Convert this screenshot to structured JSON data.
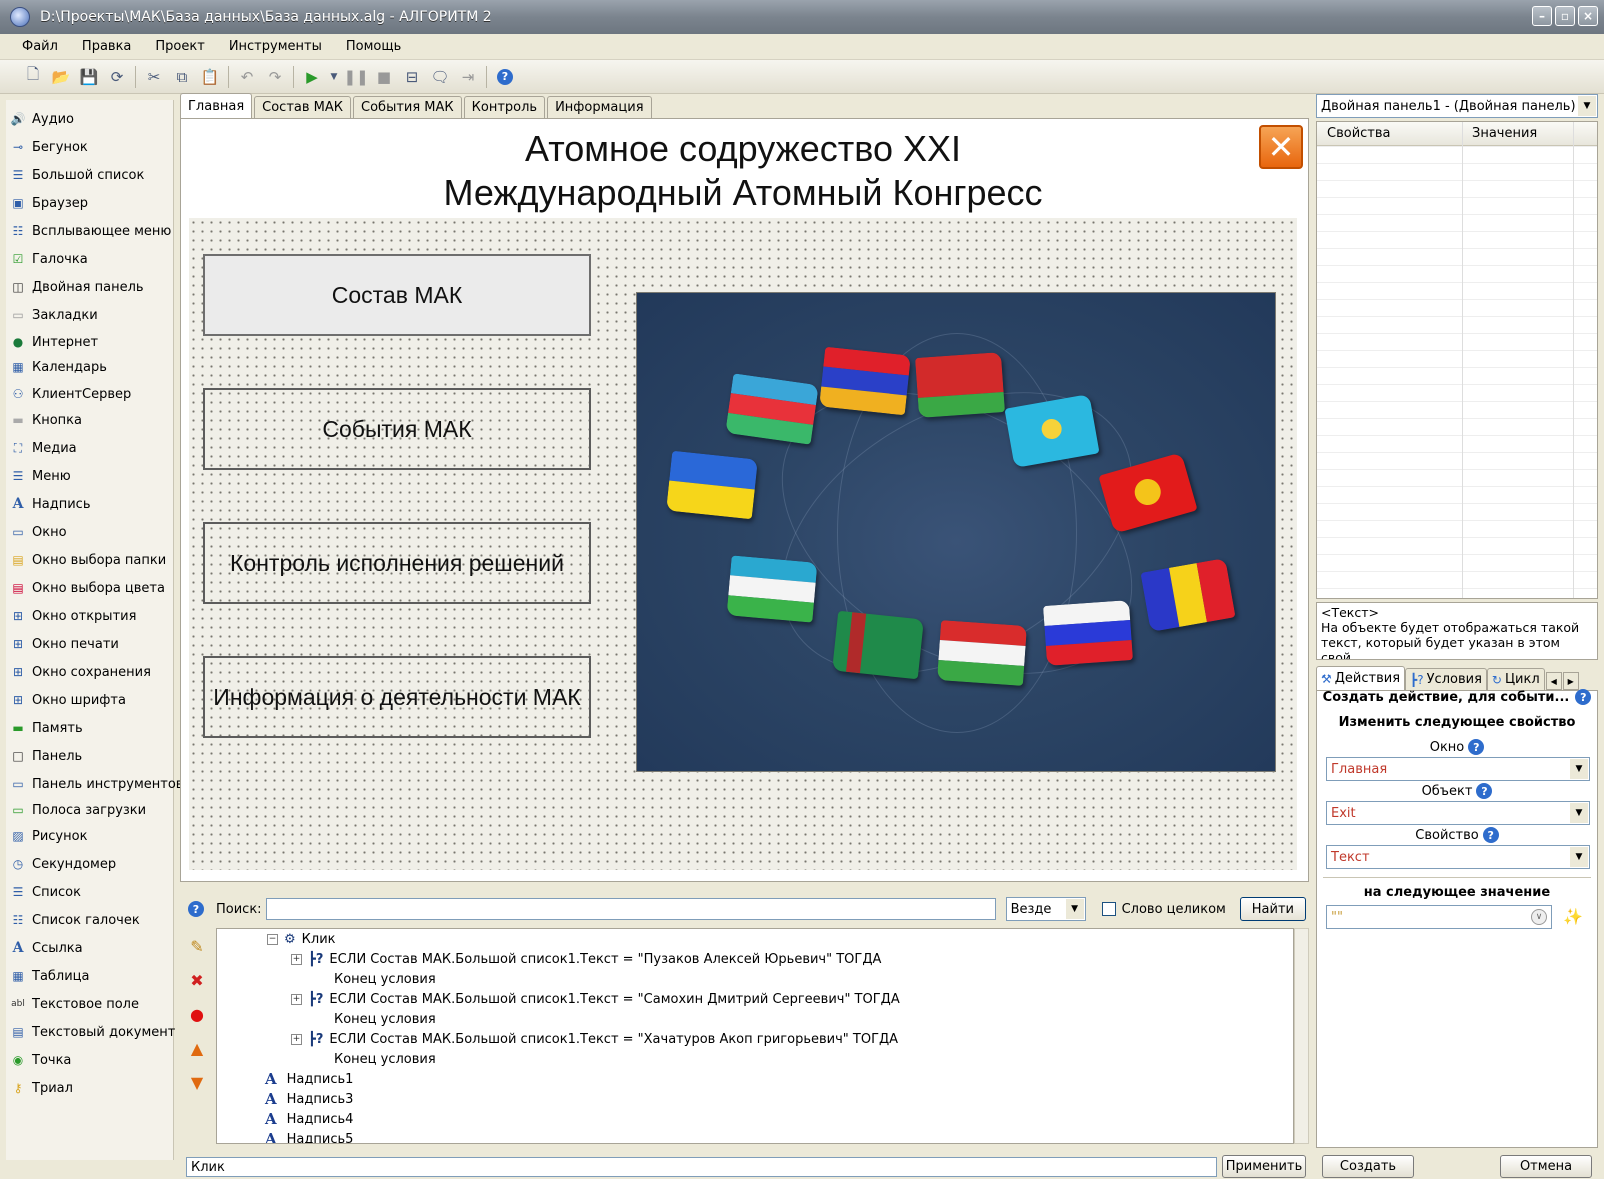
{
  "window": {
    "title": "D:\\Проекты\\МАК\\База данных\\База данных.alg - АЛГОРИТМ 2"
  },
  "menu": [
    "Файл",
    "Правка",
    "Проект",
    "Инструменты",
    "Помощь"
  ],
  "palette": [
    {
      "label": "Аудио",
      "icon": "speaker-icon"
    },
    {
      "label": "Бегунок",
      "icon": "slider-icon"
    },
    {
      "label": "Большой список",
      "icon": "list-icon"
    },
    {
      "label": "Браузер",
      "icon": "browser-icon"
    },
    {
      "label": "Всплывающее меню",
      "icon": "popup-menu-icon"
    },
    {
      "label": "Галочка",
      "icon": "checkbox-icon"
    },
    {
      "label": "Двойная панель",
      "icon": "double-panel-icon"
    },
    {
      "label": "Закладки",
      "icon": "folder-icon"
    },
    {
      "label": "Интернет",
      "icon": "globe-icon"
    },
    {
      "label": "Календарь",
      "icon": "calendar-icon"
    },
    {
      "label": "КлиентСервер",
      "icon": "network-icon"
    },
    {
      "label": "Кнопка",
      "icon": "button-icon"
    },
    {
      "label": "Медиа",
      "icon": "media-icon"
    },
    {
      "label": "Меню",
      "icon": "menu-icon"
    },
    {
      "label": "Надпись",
      "icon": "label-icon"
    },
    {
      "label": "Окно",
      "icon": "window-icon"
    },
    {
      "label": "Окно выбора папки",
      "icon": "folder-dialog-icon"
    },
    {
      "label": "Окно выбора цвета",
      "icon": "color-dialog-icon"
    },
    {
      "label": "Окно открытия",
      "icon": "open-dialog-icon"
    },
    {
      "label": "Окно печати",
      "icon": "print-dialog-icon"
    },
    {
      "label": "Окно сохранения",
      "icon": "save-dialog-icon"
    },
    {
      "label": "Окно шрифта",
      "icon": "font-dialog-icon"
    },
    {
      "label": "Память",
      "icon": "memory-icon"
    },
    {
      "label": "Панель",
      "icon": "panel-icon"
    },
    {
      "label": "Панель инструментов",
      "icon": "toolbar-icon"
    },
    {
      "label": "Полоса загрузки",
      "icon": "progressbar-icon"
    },
    {
      "label": "Рисунок",
      "icon": "picture-icon"
    },
    {
      "label": "Секундомер",
      "icon": "stopwatch-icon"
    },
    {
      "label": "Список",
      "icon": "list-icon"
    },
    {
      "label": "Список галочек",
      "icon": "checklist-icon"
    },
    {
      "label": "Ссылка",
      "icon": "link-icon"
    },
    {
      "label": "Таблица",
      "icon": "table-icon"
    },
    {
      "label": "Текстовое поле",
      "icon": "textfield-icon"
    },
    {
      "label": "Текстовый документ",
      "icon": "document-icon"
    },
    {
      "label": "Точка",
      "icon": "radio-icon"
    },
    {
      "label": "Триал",
      "icon": "key-icon"
    }
  ],
  "tabs": [
    "Главная",
    "Состав МАК",
    "События МАК",
    "Контроль",
    "Информация"
  ],
  "canvas": {
    "title_line1": "Атомное содружество XXI",
    "title_line2": "Международный Атомный Конгресс",
    "buttons": [
      "Состав МАК",
      "События МАК",
      "Контроль исполнения решений",
      "Информация о деятельности МАК"
    ]
  },
  "search": {
    "label": "Поиск:",
    "value": "",
    "scope": "Везде",
    "whole_word_label": "Слово целиком",
    "find_label": "Найти"
  },
  "tree": {
    "event": "Клик",
    "conditions": [
      {
        "if": "ЕСЛИ Состав МАК.Большой список1.Текст = \"Пузаков Алексей Юрьевич\" ТОГДА",
        "end": "Конец условия"
      },
      {
        "if": "ЕСЛИ Состав МАК.Большой список1.Текст = \"Самохин Дмитрий Сергеевич\" ТОГДА",
        "end": "Конец условия"
      },
      {
        "if": "ЕСЛИ Состав МАК.Большой список1.Текст = \"Хачатуров Акоп григорьевич\" ТОГДА",
        "end": "Конец условия"
      }
    ],
    "labels": [
      "Надпись1",
      "Надпись3",
      "Надпись4",
      "Надпись5"
    ]
  },
  "status": {
    "value": "Клик",
    "apply_label": "Применить"
  },
  "props": {
    "object": "Двойная панель1 - (Двойная панель)",
    "col_props": "Свойства",
    "col_values": "Значения",
    "desc_title": "<Текст>",
    "desc_text": "На объекте будет отображаться такой текст, который будет указан в этом свой..."
  },
  "rtabs": [
    "Действия",
    "Условия",
    "Цикл"
  ],
  "actions": {
    "create_for": "Создать действие, для событи...",
    "change_prop": "Изменить следующее свойство",
    "window_label": "Окно",
    "window_value": "Главная",
    "object_label": "Объект",
    "object_value": "Exit",
    "property_label": "Свойство",
    "property_value": "Текст",
    "next_value_label": "на следующее значение",
    "value": "\"\"",
    "create_label": "Создать",
    "cancel_label": "Отмена"
  }
}
